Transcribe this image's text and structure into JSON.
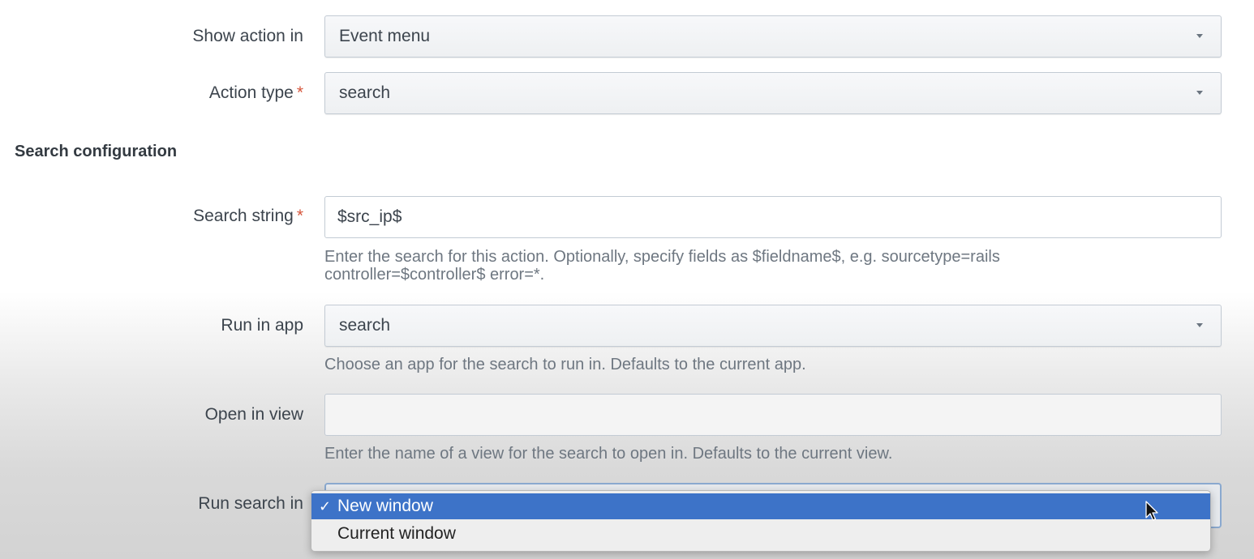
{
  "fields": {
    "show_action_in": {
      "label": "Show action in",
      "value": "Event menu"
    },
    "action_type": {
      "label": "Action type",
      "required_mark": "*",
      "value": "search"
    },
    "search_string": {
      "label": "Search string",
      "required_mark": "*",
      "value": "$src_ip$",
      "help_line1": "Enter the search for this action. Optionally, specify fields as $fieldname$, e.g. sourcetype=rails",
      "help_line2": "controller=$controller$ error=*."
    },
    "run_in_app": {
      "label": "Run in app",
      "value": "search",
      "help": "Choose an app for the search to run in. Defaults to the current app."
    },
    "open_in_view": {
      "label": "Open in view",
      "value": "",
      "help": "Enter the name of a view for the search to open in. Defaults to the current view."
    },
    "run_search_in": {
      "label": "Run search in",
      "options": [
        {
          "label": "New window",
          "selected": true,
          "check": "✓"
        },
        {
          "label": "Current window",
          "selected": false
        }
      ]
    }
  },
  "section": {
    "title": "Search configuration"
  },
  "colors": {
    "accent": "#3d73c8",
    "required": "#d6563c",
    "label_text": "#3c444d",
    "help_text": "#6e7781"
  },
  "icons": {
    "dropdown_caret": "chevron-down-icon",
    "checkmark": "checkmark-icon",
    "cursor": "mouse-pointer-icon"
  }
}
